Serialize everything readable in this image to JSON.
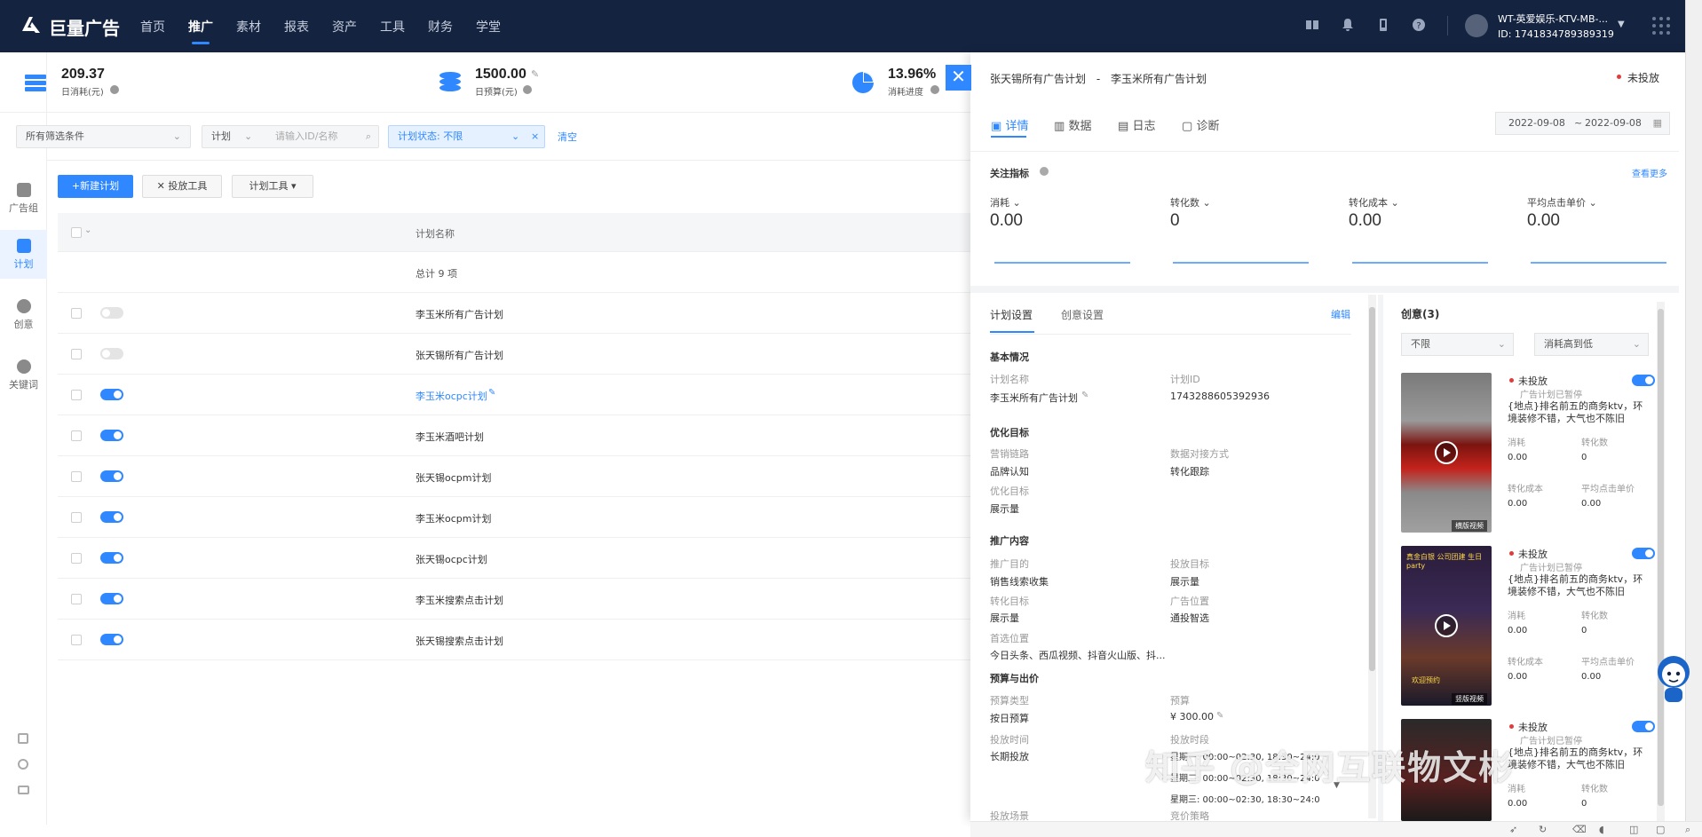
{
  "brand": {
    "name": "巨量广告"
  },
  "nav": [
    {
      "label": "首页"
    },
    {
      "label": "推广"
    },
    {
      "label": "素材"
    },
    {
      "label": "报表"
    },
    {
      "label": "资产"
    },
    {
      "label": "工具"
    },
    {
      "label": "财务"
    },
    {
      "label": "学堂"
    }
  ],
  "nav_active": "推广",
  "account": {
    "name": "WT-英爱娱乐-KTV-MB-...",
    "id": "ID: 1741834789389319"
  },
  "sidebar": [
    {
      "label": "广告组",
      "icon": "chart-icon"
    },
    {
      "label": "计划",
      "icon": "document-icon"
    },
    {
      "label": "创意",
      "icon": "bulb-icon"
    },
    {
      "label": "关键词",
      "icon": "target-icon"
    }
  ],
  "stats": [
    {
      "value": "209.37",
      "label": "日消耗(元)"
    },
    {
      "value": "1500.00",
      "label": "日预算(元)"
    },
    {
      "value": "13.96%",
      "label": "消耗进度"
    }
  ],
  "filters": {
    "all_conditions": "所有筛选条件",
    "scope": "计划",
    "search_placeholder": "请输入ID/名称",
    "status_chip": "计划状态:  不限",
    "clear": "清空"
  },
  "toolbar": {
    "new_plan": "+新建计划",
    "delivery_tools": "投放工具",
    "plan_tools": "计划工具"
  },
  "table": {
    "header_name": "计划名称",
    "total": "总计 9 项",
    "rows": [
      {
        "name": "李玉米所有广告计划",
        "on": false,
        "link": false
      },
      {
        "name": "张天锡所有广告计划",
        "on": false,
        "link": false
      },
      {
        "name": "李玉米ocpc计划",
        "on": true,
        "link": true
      },
      {
        "name": "李玉米酒吧计划",
        "on": true,
        "link": false
      },
      {
        "name": "张天锡ocpm计划",
        "on": true,
        "link": false
      },
      {
        "name": "李玉米ocpm计划",
        "on": true,
        "link": false
      },
      {
        "name": "张天锡ocpc计划",
        "on": true,
        "link": false
      },
      {
        "name": "李玉米搜索点击计划",
        "on": true,
        "link": false
      },
      {
        "name": "张天锡搜索点击计划",
        "on": true,
        "link": false
      }
    ]
  },
  "panel": {
    "breadcrumb_parent": "张天锡所有广告计划",
    "breadcrumb_sep": "-",
    "breadcrumb_current": "李玉米所有广告计划",
    "status": "未投放",
    "tabs": [
      "详情",
      "数据",
      "日志",
      "诊断"
    ],
    "date_from": "2022-09-08",
    "date_sep": "~",
    "date_to": "2022-09-08",
    "focus_title": "关注指标",
    "view_more": "查看更多",
    "metrics": [
      {
        "name": "消耗",
        "value": "0.00"
      },
      {
        "name": "转化数",
        "value": "0"
      },
      {
        "name": "转化成本",
        "value": "0.00"
      },
      {
        "name": "平均点击单价",
        "value": "0.00"
      }
    ],
    "settings_tabs": [
      "计划设置",
      "创意设置"
    ],
    "edit": "编辑",
    "basic_title": "基本情况",
    "fields": {
      "plan_name_label": "计划名称",
      "plan_name": "李玉米所有广告计划",
      "plan_id_label": "计划ID",
      "plan_id": "1743288605392936",
      "opt_title": "优化目标",
      "marketing_label": "营销链路",
      "marketing": "品牌认知",
      "data_label": "数据对接方式",
      "data": "转化跟踪",
      "goal_label": "优化目标",
      "goal": "展示量",
      "promo_title": "推广内容",
      "purpose_label": "推广目的",
      "purpose": "销售线索收集",
      "target_label": "投放目标",
      "target": "展示量",
      "conv_label": "转化目标",
      "conv": "展示量",
      "position_label": "广告位置",
      "position": "通投智选",
      "pref_label": "首选位置",
      "pref": "今日头条、西瓜视频、抖音火山版、抖...",
      "budget_title": "预算与出价",
      "btype_label": "预算类型",
      "btype": "按日预算",
      "budget_label": "预算",
      "budget": "¥ 300.00",
      "time_label": "投放时间",
      "time": "长期投放",
      "period_label": "投放时段",
      "periods": [
        "星期一: 00:00~02:30, 18:30~24:0",
        "星期二: 00:00~02:30, 18:30~24:0",
        "星期三: 00:00~02:30, 18:30~24:0"
      ],
      "scene_label": "投放场景",
      "bid_label": "竞价策略"
    },
    "creatives_title": "创意(3)",
    "creative_filter_1": "不限",
    "creative_filter_2": "消耗高到低",
    "creatives": [
      {
        "status": "未投放",
        "sub": "广告计划已暂停",
        "title": "{地点}排名前五的商务ktv，环境装修不错，大气也不陈旧",
        "badge": "横版视频",
        "m1_label": "消耗",
        "m1": "0.00",
        "m2_label": "转化数",
        "m2": "0",
        "m3_label": "转化成本",
        "m3": "0.00",
        "m4_label": "平均点击单价",
        "m4": "0.00"
      },
      {
        "status": "未投放",
        "sub": "广告计划已暂停",
        "title": "{地点}排名前五的商务ktv，环境装修不错，大气也不陈旧",
        "badge": "竖版视频",
        "m1_label": "消耗",
        "m1": "0.00",
        "m2_label": "转化数",
        "m2": "0",
        "m3_label": "转化成本",
        "m3": "0.00",
        "m4_label": "平均点击单价",
        "m4": "0.00"
      },
      {
        "status": "未投放",
        "sub": "广告计划已暂停",
        "title": "{地点}排名前五的商务ktv，环境装修不错，大气也不陈旧",
        "badge": "",
        "m1_label": "消耗",
        "m1": "0.00",
        "m2_label": "转化数",
        "m2": "0",
        "m3_label": "",
        "m3": "",
        "m4_label": "",
        "m4": ""
      }
    ],
    "thumb_text_2": "真金白银 公司团建 生日party",
    "thumb_text_2b": "欢迎预约"
  },
  "watermark": "知乎 @全网互联物文彬",
  "colors": {
    "accent": "#2f88ff",
    "topbar": "#142340",
    "status_red": "#e23b3b"
  }
}
